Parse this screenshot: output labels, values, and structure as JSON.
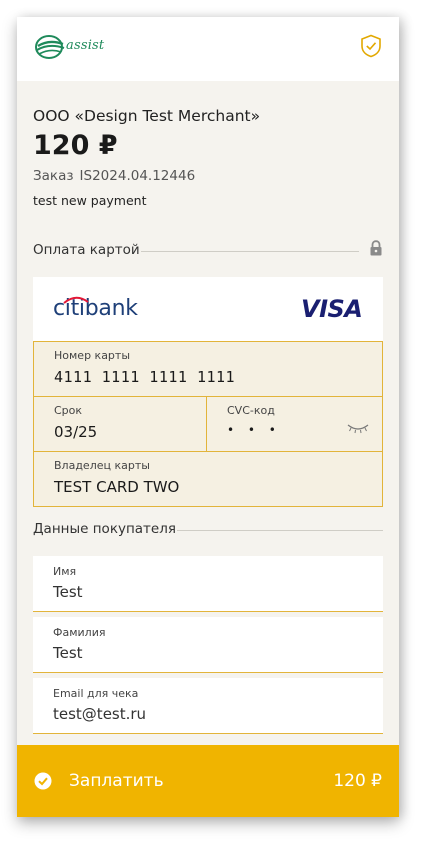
{
  "header": {
    "logo_text": "assist",
    "icons": {
      "logo": "assist-logo-icon",
      "shield": "shield-check-icon"
    }
  },
  "order": {
    "merchant": "ООО «Design Test Merchant»",
    "amount": "120 ₽",
    "order_label": "Заказ",
    "order_number": "IS2024.04.12446",
    "description": "test new payment"
  },
  "card_section": {
    "title": "Оплата картой",
    "bank_name_red": "citi",
    "bank_name_blue": "bank",
    "brand": "VISA",
    "fields": {
      "card_number_label": "Номер карты",
      "card_number_value": "4111 1111 1111 1111",
      "expiry_label": "Срок",
      "expiry_value": "03/25",
      "cvc_label": "CVC-код",
      "cvc_value": "• • •",
      "holder_label": "Владелец карты",
      "holder_value": "TEST CARD TWO"
    }
  },
  "buyer_section": {
    "title": "Данные покупателя",
    "fields": [
      {
        "label": "Имя",
        "value": "Test"
      },
      {
        "label": "Фамилия",
        "value": "Test"
      },
      {
        "label": "Email для чека",
        "value": "test@test.ru"
      }
    ]
  },
  "pay_button": {
    "label": "Заплатить",
    "amount": "120 ₽"
  },
  "colors": {
    "accent": "#f0b400",
    "field_border": "#e2b43a",
    "background": "#f5f3ee",
    "visa_blue": "#1a1f71",
    "citi_blue": "#1e3f78",
    "citi_red": "#e31837",
    "logo_green": "#1f8a5b"
  }
}
